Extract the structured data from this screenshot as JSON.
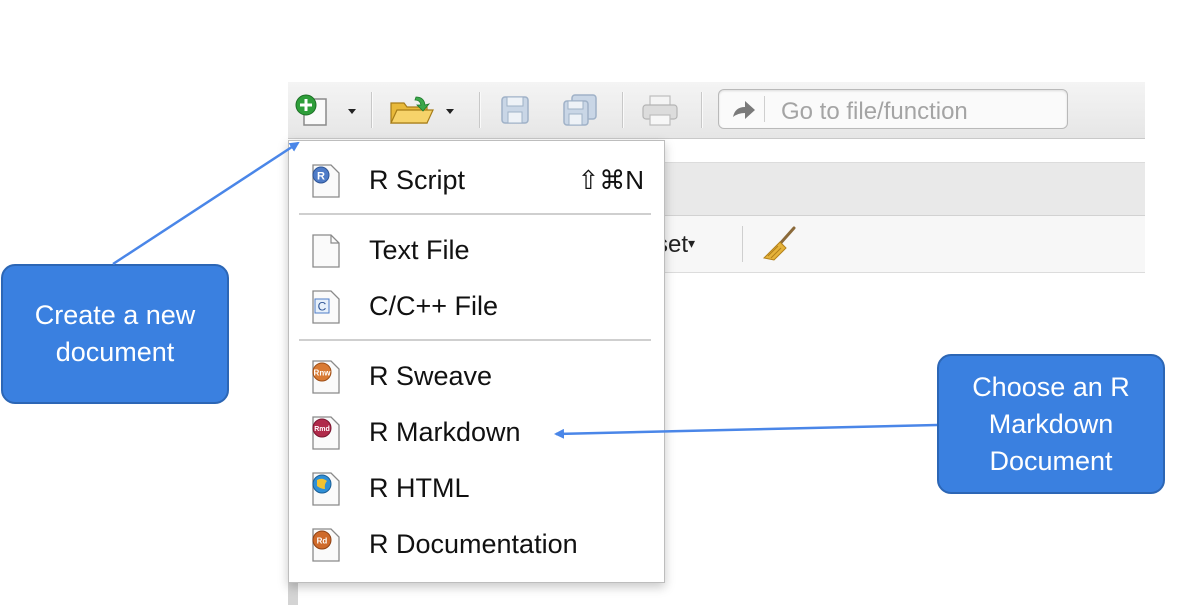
{
  "toolbar": {
    "goto_placeholder": "Go to file/function"
  },
  "panel": {
    "partial_label": "set"
  },
  "menu": {
    "items": [
      {
        "label": "R Script",
        "shortcut": "⇧⌘N",
        "icon": "r-script-icon"
      },
      {
        "label": "Text File",
        "icon": "text-file-icon"
      },
      {
        "label": "C/C++ File",
        "icon": "c-file-icon"
      },
      {
        "label": "R Sweave",
        "icon": "r-sweave-icon"
      },
      {
        "label": "R Markdown",
        "icon": "r-markdown-icon"
      },
      {
        "label": "R HTML",
        "icon": "r-html-icon"
      },
      {
        "label": "R Documentation",
        "icon": "r-documentation-icon"
      }
    ]
  },
  "callouts": {
    "new_document": {
      "line1": "Create a new",
      "line2": "document"
    },
    "markdown": {
      "line1": "Choose an R",
      "line2": "Markdown",
      "line3": "Document"
    }
  },
  "colors": {
    "callout_fill": "#3a80e0",
    "arrow": "#4a86e8"
  }
}
